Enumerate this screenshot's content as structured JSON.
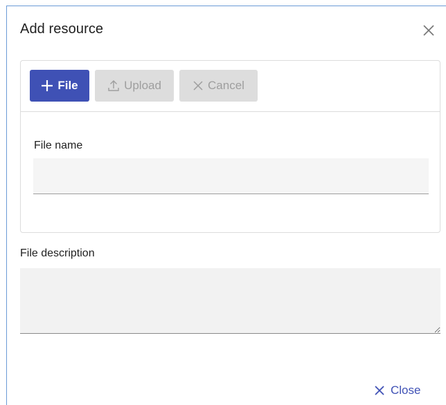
{
  "dialog": {
    "title": "Add resource",
    "close_icon": "close-icon"
  },
  "toolbar": {
    "file_button": {
      "label": "File",
      "icon": "plus-icon"
    },
    "upload_button": {
      "label": "Upload",
      "icon": "upload-icon",
      "disabled": true
    },
    "cancel_button": {
      "label": "Cancel",
      "icon": "close-icon",
      "disabled": true
    }
  },
  "form": {
    "file_name": {
      "label": "File name",
      "value": ""
    },
    "file_description": {
      "label": "File description",
      "value": ""
    }
  },
  "footer": {
    "close_label": "Close",
    "close_icon": "close-icon"
  },
  "colors": {
    "primary": "#3f51b5",
    "disabled_bg": "#dddddd",
    "disabled_text": "#9e9e9e",
    "field_bg": "#f5f5f5",
    "dialog_border": "#6a9ad6"
  }
}
